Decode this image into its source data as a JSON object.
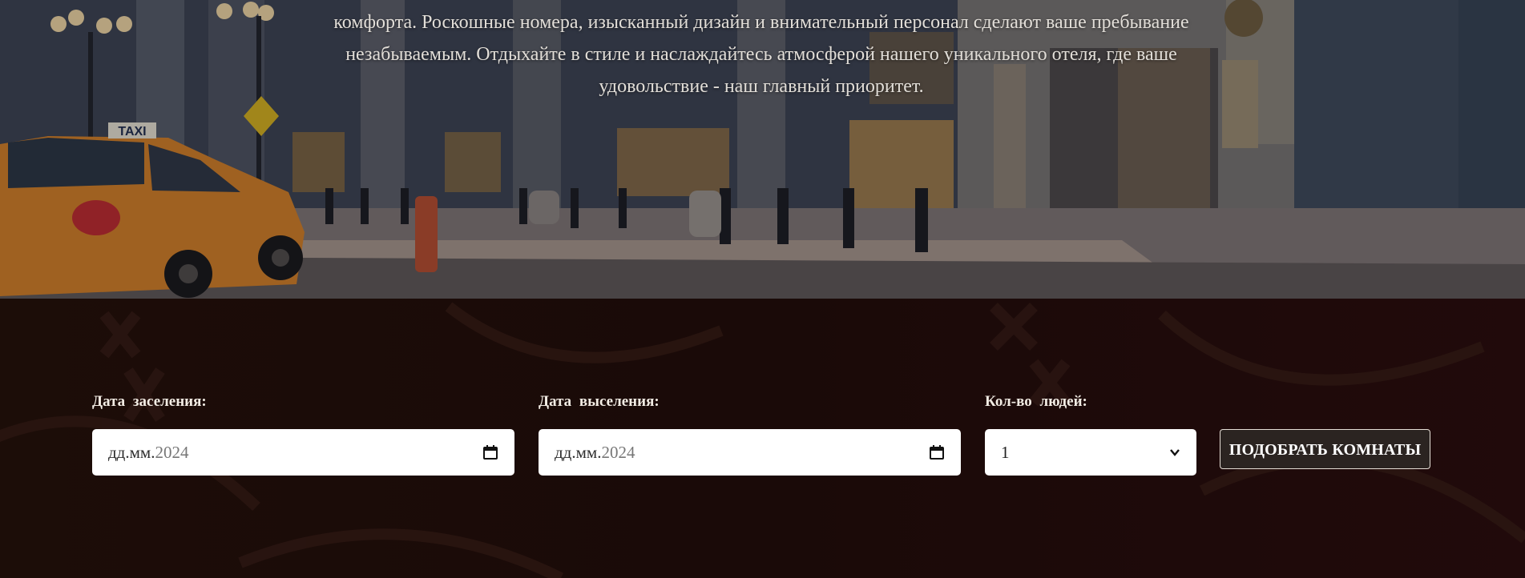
{
  "hero": {
    "description_lines": [
      "комфорта. Роскошные номера, изысканный дизайн и внимательный персонал сделают ваше пребывание",
      "незабываемым. Отдыхайте в стиле и наслаждайтесь атмосферой нашего уникального отеля, где ваше",
      "удовольствие - наш главный приоритет."
    ],
    "taxi_sign": "TAXI"
  },
  "booking": {
    "checkin": {
      "label": "Дата заселения:",
      "mask": "дд.мм.",
      "year": "2024",
      "icon": "calendar-icon"
    },
    "checkout": {
      "label": "Дата выселения:",
      "mask": "дд.мм.",
      "year": "2024",
      "icon": "calendar-icon"
    },
    "guests": {
      "label": "Кол-во людей:",
      "value": "1",
      "icon": "chevron-down-icon"
    },
    "submit_label": "ПОДОБРАТЬ КОМНАТЫ"
  },
  "colors": {
    "booking_background": "#1a0b09",
    "button_background": "#2b2421",
    "label_text": "#f2ece4"
  }
}
